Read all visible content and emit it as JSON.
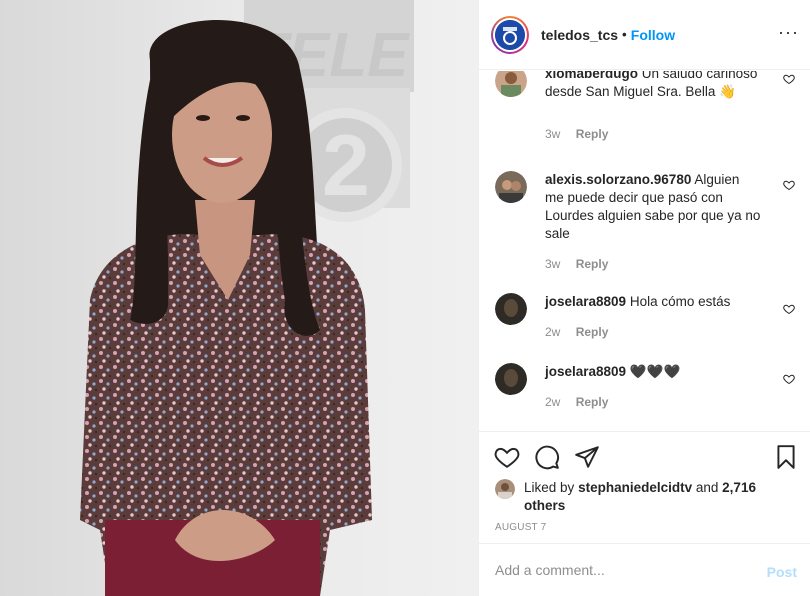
{
  "header": {
    "username": "teledos_tcs",
    "separator": "•",
    "follow_label": "Follow",
    "more_icon": "more-options-icon"
  },
  "photo": {
    "sign_text": "TELE",
    "sign_number": "2"
  },
  "comments": [
    {
      "username": "xiomaberdugo",
      "text": "Un saludo cariñoso desde San Miguel Sra. Bella 👋",
      "time": "3w",
      "reply_label": "Reply"
    },
    {
      "username": "alexis.solorzano.96780",
      "text": "Alguien me puede decir que pasó con Lourdes alguien sabe por que ya no sale",
      "time": "3w",
      "reply_label": "Reply"
    },
    {
      "username": "joselara8809",
      "text": "Hola cómo estás",
      "time": "2w",
      "reply_label": "Reply"
    },
    {
      "username": "joselara8809",
      "text": "🖤🖤🖤",
      "time": "2w",
      "reply_label": "Reply"
    }
  ],
  "likes": {
    "prefix": "Liked by",
    "username": "stephaniedelcidtv",
    "conjunction": "and",
    "others": "2,716 others"
  },
  "date": "AUGUST 7",
  "add_comment": {
    "placeholder": "Add a comment...",
    "post_label": "Post"
  },
  "colors": {
    "accent": "#0095f6",
    "post_disabled": "#b2dffc",
    "muted": "#8e8e8e",
    "border": "#efefef"
  }
}
